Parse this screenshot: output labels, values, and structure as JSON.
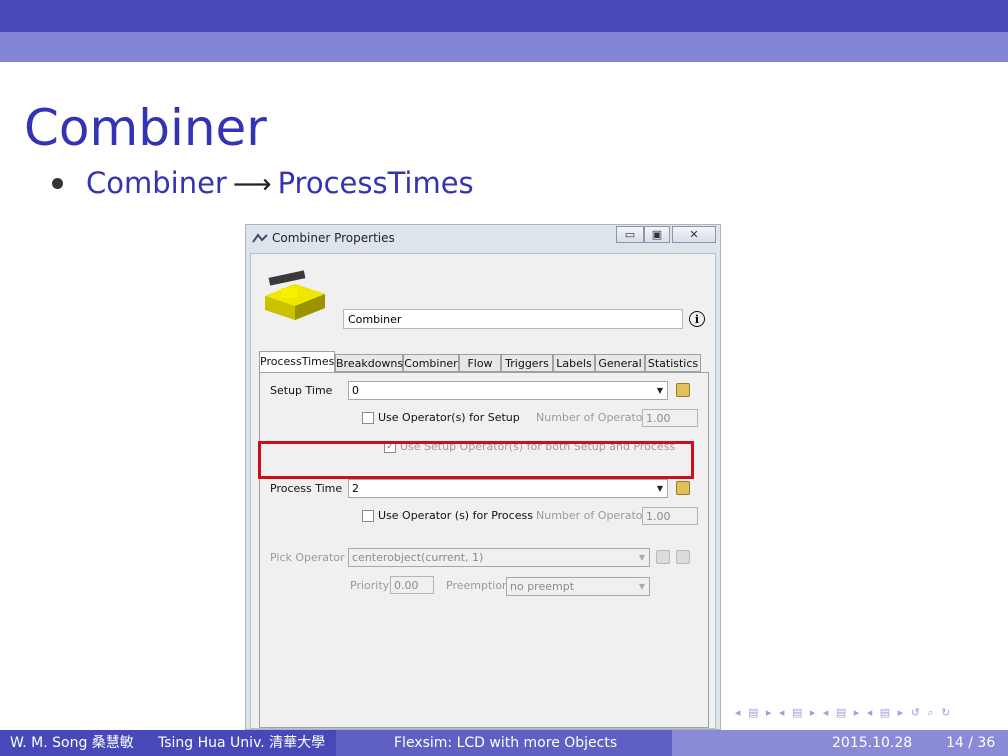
{
  "slide": {
    "title": "Combiner",
    "bullet": {
      "from": "Combiner",
      "arrow": "⟶",
      "to": "ProcessTimes"
    }
  },
  "dialog": {
    "title": "Combiner  Properties",
    "buttons": {
      "minimize": "▭",
      "maximize": "▣",
      "close": "✕"
    },
    "object_name": "Combiner",
    "info_glyph": "i",
    "tabs": [
      "ProcessTimes",
      "Breakdowns",
      "Combiner",
      "Flow",
      "Triggers",
      "Labels",
      "General",
      "Statistics"
    ],
    "active_tab": "ProcessTimes",
    "setup_time_label": "Setup Time",
    "setup_time_value": "0",
    "use_operator_setup": "Use Operator(s) for Setup",
    "num_operators_label": "Number of Operators",
    "num_operators_setup": "1.00",
    "use_setup_both": "Use Setup Operator(s) for both Setup and Process",
    "use_setup_both_checked": true,
    "process_time_label": "Process Time",
    "process_time_value": "2",
    "use_operator_process": "Use Operator (s) for Process",
    "num_operators_process": "1.00",
    "pick_operator_label": "Pick Operator",
    "pick_operator_value": "centerobject(current, 1)",
    "priority_label": "Priority",
    "priority_value": "0.00",
    "preemption_label": "Preemption",
    "preemption_value": "no preempt"
  },
  "footer": {
    "author": "W. M. Song 桑慧敏",
    "institution": "Tsing Hua Univ. 清華大學",
    "talk_title": "Flexsim: LCD with more Objects",
    "date": "2015.10.28",
    "page": "14 / 36"
  },
  "colors": {
    "header_dark": "#4848b8",
    "header_light": "#8484d4",
    "title_blue": "#3333b3",
    "highlight_red": "#cc0f1a"
  }
}
